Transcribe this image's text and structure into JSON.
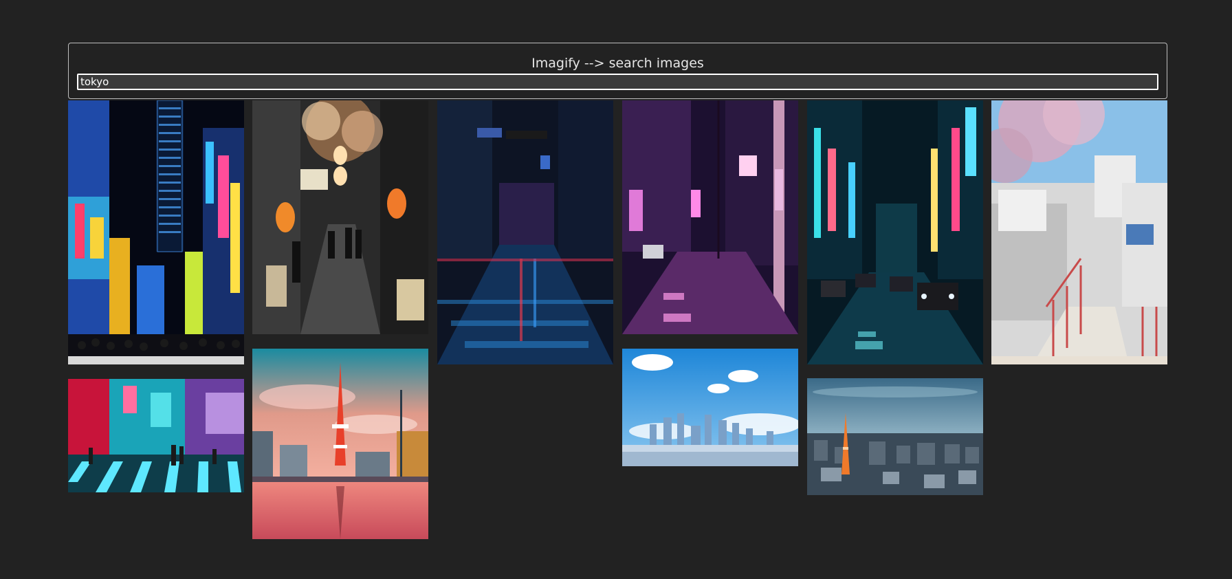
{
  "app": {
    "title": "Imagify --> search images"
  },
  "search": {
    "value": "tokyo"
  },
  "results": [
    {
      "subject": "Neon-lit Shinjuku street with crowd at night"
    },
    {
      "subject": "Narrow alley with paper lanterns and cherry blossoms"
    },
    {
      "subject": "Rainy night street with red traffic light"
    },
    {
      "subject": "Purple-lit street with utility pole at night"
    },
    {
      "subject": "Taxis on neon-lit street at night"
    },
    {
      "subject": "Hillside stairway with cherry blossom tree"
    },
    {
      "subject": "Shibuya crossing with neon lights"
    },
    {
      "subject": "Tokyo Tower at sunset with reflection"
    },
    {
      "subject": "City skyline under blue sky and clouds"
    },
    {
      "subject": "Aerial view of Tokyo with Tokyo Tower"
    }
  ]
}
